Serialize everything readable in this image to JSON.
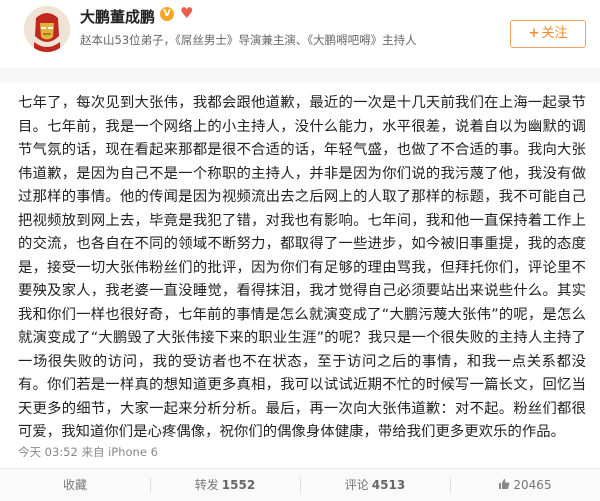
{
  "user": {
    "name": "大鹏董成鹏",
    "verified_icon": "verified-v-icon",
    "bio": "赵本山53位弟子，《屌丝男士》导演兼主演、《大鹏嘚吧嘚》主持人"
  },
  "follow_button": {
    "plus": "+",
    "label": "关注"
  },
  "post": {
    "text": "七年了，每次见到大张伟，我都会跟他道歉，最近的一次是十几天前我们在上海一起录节目。七年前，我是一个网络上的小主持人，没什么能力，水平很差，说着自以为幽默的调节气氛的话，现在看起来那都是很不合适的话，年轻气盛，也做了不合适的事。我向大张伟道歉，是因为自己不是一个称职的主持人，并非是因为你们说的我污蔑了他，我没有做过那样的事情。他的传闻是因为视频流出去之后网上的人取了那样的标题，我不可能自己把视频放到网上去，毕竟是我犯了错，对我也有影响。七年间，我和他一直保持着工作上的交流，也各自在不同的领域不断努力，都取得了一些进步，如今被旧事重提，我的态度是，接受一切大张伟粉丝们的批评，因为你们有足够的理由骂我，但拜托你们，评论里不要殃及家人，我老婆一直没睡觉，看得抹泪，我才觉得自己必须要站出来说些什么。其实我和你们一样也很好奇，七年前的事情是怎么就演变成了“大鹏污蔑大张伟”的呢，是怎么就演变成了“大鹏毁了大张伟接下来的职业生涯”的呢？我只是一个很失败的主持人主持了一场很失败的访问，我的受访者也不在状态，至于访问之后的事情，和我一点关系都没有。你们若是一样真的想知道更多真相，我可以试试近期不忙的时候写一篇长文，回忆当天更多的细节，大家一起来分析分析。最后，再一次向大张伟道歉：对不起。粉丝们都很可爱，我知道你们是心疼偶像，祝你们的偶像身体健康，带给我们更多更欢乐的作品。",
    "meta": "今天 03:52 来自 iPhone 6"
  },
  "actions": {
    "favorite_label": "收藏",
    "repost_label": "转发",
    "repost_count": "1552",
    "comment_label": "评论",
    "comment_count": "4513",
    "like_icon": "thumbs-up-icon",
    "like_count": "20465"
  },
  "colors": {
    "accent_orange": "#f28b2b",
    "verified": "#f6a623",
    "heart": "#e8604c"
  }
}
